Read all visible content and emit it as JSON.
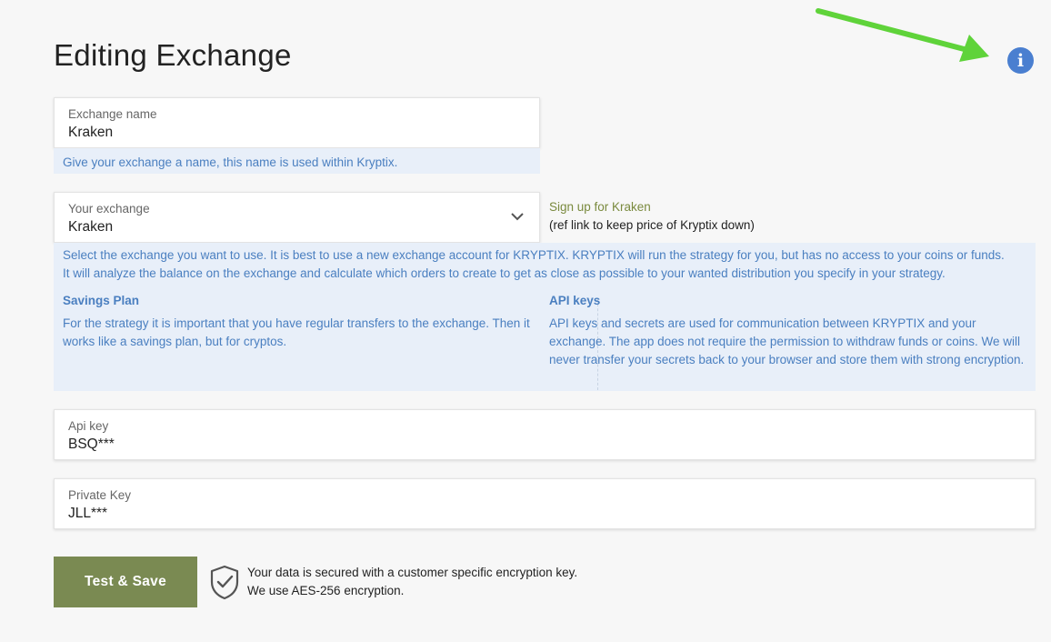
{
  "page": {
    "title": "Editing Exchange",
    "info_icon": "info-circle-icon",
    "info_glyph": "i"
  },
  "exchange_name": {
    "label": "Exchange name",
    "value": "Kraken",
    "help": "Give your exchange a name, this name is used within Kryptix."
  },
  "your_exchange": {
    "label": "Your exchange",
    "value": "Kraken",
    "signup_link": "Sign up for Kraken",
    "signup_note": "(ref link to keep price of Kryptix down)",
    "help_line1": "Select the exchange you want to use. It is best to use a new exchange account for KRYPTIX. KRYPTIX will run the strategy for you, but has no access to your coins or funds.",
    "help_line2": "It will analyze the balance on the exchange and calculate which orders to create to get as close as possible to your wanted distribution you specify in your strategy.",
    "savings_title": "Savings Plan",
    "savings_text": "For the strategy it is important that you have regular transfers to the exchange. Then it works like a savings plan, but for cryptos.",
    "api_title": "API keys",
    "api_text": "API keys and secrets are used for communication between KRYPTIX and your exchange. The app does not require the permission to withdraw funds or coins. We will never transfer your secrets back to your browser and store them with strong encryption."
  },
  "api_key": {
    "label": "Api key",
    "value": "BSQ***"
  },
  "private_key": {
    "label": "Private Key",
    "value": "JLL***"
  },
  "footer": {
    "save_label": "Test & Save",
    "secure_line1": "Your data is secured with a customer specific encryption key.",
    "secure_line2": "We use AES-256 encryption."
  },
  "colors": {
    "accent_green": "#7a8a52",
    "help_bg": "#e8eff9",
    "help_text": "#4a7fc0",
    "info_blue": "#4a7fd0",
    "annotation_arrow": "#5fd33a"
  }
}
